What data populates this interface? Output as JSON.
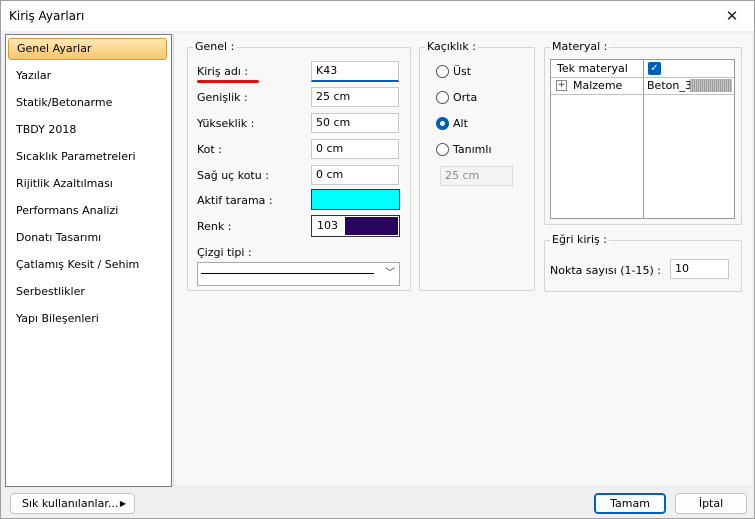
{
  "window": {
    "title": "Kiriş Ayarları"
  },
  "icons": {
    "close": "close-icon",
    "checkbox": "checkmark-icon",
    "expand": "plus-expand-icon",
    "dropdown": "chevron-down-icon",
    "menu_arrow": "triangle-right-icon"
  },
  "colors": {
    "accent": "#005fb8",
    "selection": "#f8c66a",
    "aktif_tarama": "#00ffff",
    "renk": "#28045a",
    "underline": "#e01010"
  },
  "sidebar": {
    "items": [
      {
        "label": "Genel Ayarlar",
        "active": true
      },
      {
        "label": "Yazılar"
      },
      {
        "label": "Statik/Betonarme"
      },
      {
        "label": "TBDY 2018"
      },
      {
        "label": "Sıcaklık Parametreleri"
      },
      {
        "label": "Rijitlik Azaltılması"
      },
      {
        "label": "Performans Analizi"
      },
      {
        "label": "Donatı Tasarımı"
      },
      {
        "label": "Çatlamış Kesit / Sehim"
      },
      {
        "label": "Serbestlikler"
      },
      {
        "label": "Yapı Bileşenleri"
      }
    ]
  },
  "genel": {
    "title": "Genel :",
    "kiris_adi_label": "Kiriş adı :",
    "kiris_adi": "K43",
    "genislik_label": "Genişlik :",
    "genislik": "25 cm",
    "yukseklik_label": "Yükseklik :",
    "yukseklik": "50 cm",
    "kot_label": "Kot :",
    "kot": "0 cm",
    "sag_uc_kotu_label": "Sağ uç kotu :",
    "sag_uc_kotu": "0 cm",
    "aktif_tarama_label": "Aktif tarama :",
    "renk_label": "Renk :",
    "renk_value": "103",
    "cizgi_tipi_label": "Çizgi tipi :"
  },
  "kaciklik": {
    "title": "Kaçıklık :",
    "options": [
      {
        "label": "Üst",
        "checked": false
      },
      {
        "label": "Orta",
        "checked": false
      },
      {
        "label": "Alt",
        "checked": true
      },
      {
        "label": "Tanımlı",
        "checked": false
      }
    ],
    "tanimli_value": "25 cm"
  },
  "materyal": {
    "title": "Materyal :",
    "rows": [
      {
        "name": "Tek materyal",
        "checked": true
      },
      {
        "name": "Malzeme",
        "value": "Beton_3"
      }
    ]
  },
  "egri_kiris": {
    "title": "Eğri kiriş :",
    "nokta_label": "Nokta sayısı (1-15) :",
    "nokta_value": "10"
  },
  "footer": {
    "frequent_label": "Sık kullanılanlar...",
    "ok_label": "Tamam",
    "cancel_label": "İptal"
  }
}
